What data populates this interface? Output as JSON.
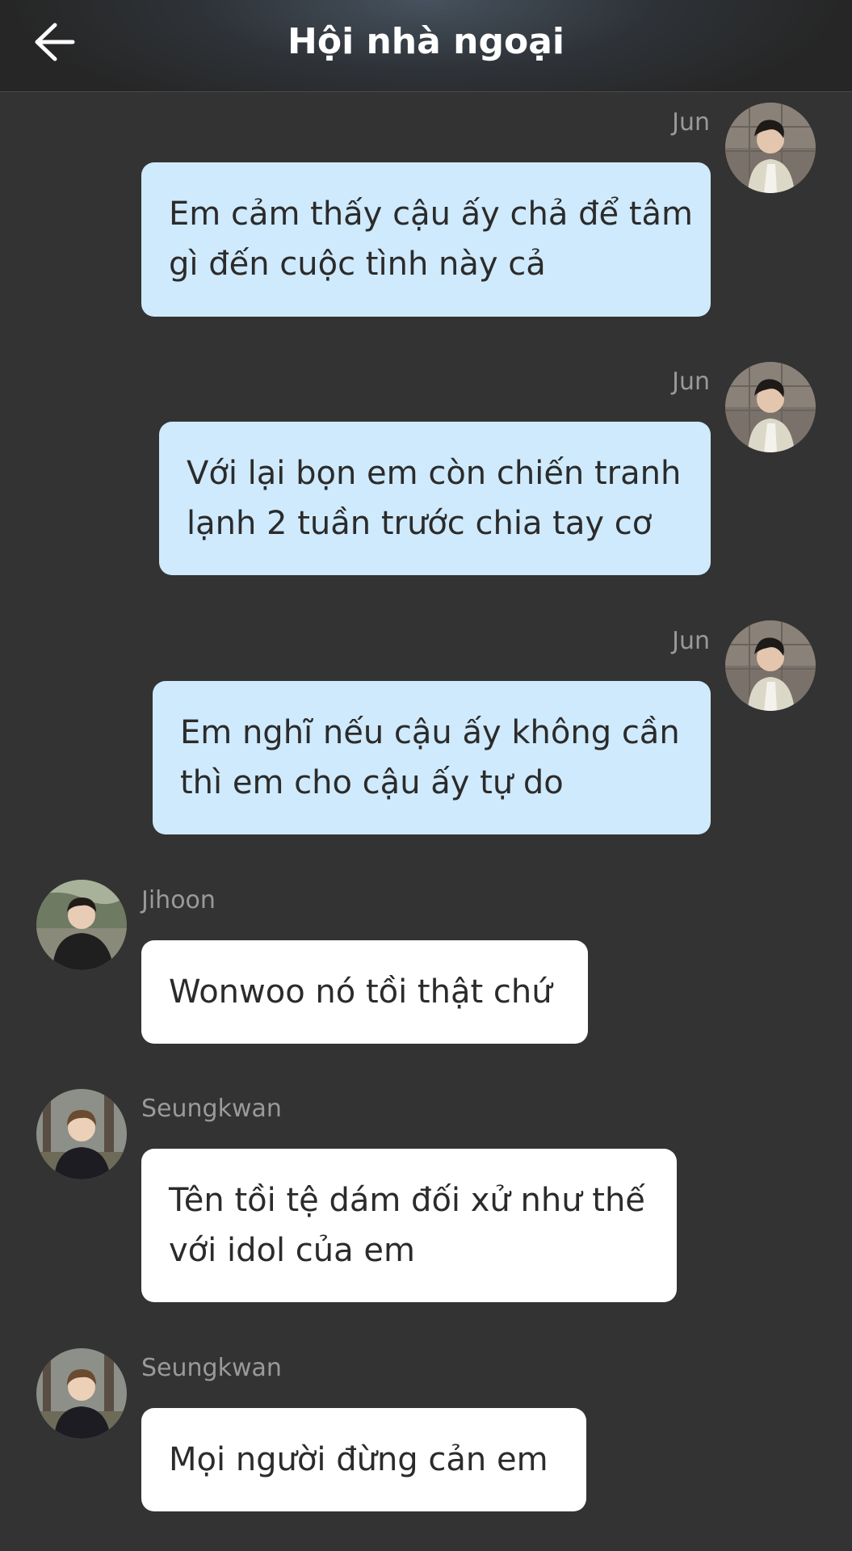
{
  "header": {
    "title": "Hội nhà ngoại",
    "back_icon": "arrow-left-icon"
  },
  "colors": {
    "background": "#333333",
    "outgoing_bubble": "#cfeafc",
    "incoming_bubble": "#ffffff",
    "sender_name": "#9a9a9a"
  },
  "messages": [
    {
      "sender": "Jun",
      "direction": "outgoing",
      "lines": [
        "Em cảm thấy cậu ấy chả để tâm",
        "gì đến cuộc tình này cả"
      ]
    },
    {
      "sender": "Jun",
      "direction": "outgoing",
      "lines": [
        "Với lại bọn em còn chiến tranh",
        "lạnh 2 tuần trước chia tay cơ"
      ]
    },
    {
      "sender": "Jun",
      "direction": "outgoing",
      "lines": [
        "Em nghĩ nếu cậu ấy không cần",
        "thì em cho cậu ấy tự do"
      ]
    },
    {
      "sender": "Jihoon",
      "direction": "incoming",
      "lines": [
        "Wonwoo nó tồi thật chứ"
      ]
    },
    {
      "sender": "Seungkwan",
      "direction": "incoming",
      "lines": [
        "Tên tồi tệ dám đối xử như thế",
        "với idol của em"
      ]
    },
    {
      "sender": "Seungkwan",
      "direction": "incoming",
      "lines": [
        "Mọi người đừng cản em"
      ]
    }
  ]
}
